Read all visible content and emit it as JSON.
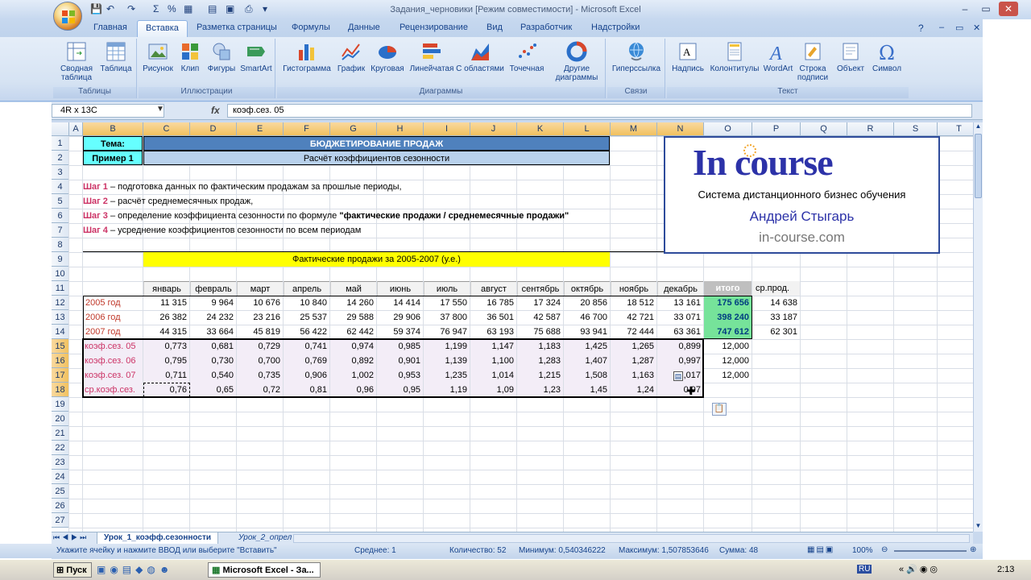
{
  "window": {
    "title": "Задания_черновики  [Режим совместимости] - Microsoft Excel"
  },
  "tabs": [
    "Главная",
    "Вставка",
    "Разметка страницы",
    "Формулы",
    "Данные",
    "Рецензирование",
    "Вид",
    "Разработчик",
    "Надстройки"
  ],
  "active_tab": "Вставка",
  "ribbon": {
    "groups": [
      {
        "label": "Таблицы",
        "buttons": [
          "Сводная таблица",
          "Таблица"
        ]
      },
      {
        "label": "Иллюстрации",
        "buttons": [
          "Рисунок",
          "Клип",
          "Фигуры",
          "SmartArt"
        ]
      },
      {
        "label": "Диаграммы",
        "buttons": [
          "Гистограмма",
          "График",
          "Круговая",
          "Линейчатая",
          "С областями",
          "Точечная",
          "Другие диаграммы"
        ]
      },
      {
        "label": "Связи",
        "buttons": [
          "Гиперссылка"
        ]
      },
      {
        "label": "Текст",
        "buttons": [
          "Надпись",
          "Колонтитулы",
          "WordArt",
          "Строка подписи",
          "Объект",
          "Символ"
        ]
      }
    ]
  },
  "formula_bar": {
    "name_box": "4R x 13C",
    "fx": "fx",
    "formula": "коэф.сез. 05"
  },
  "columns": [
    "A",
    "B",
    "C",
    "D",
    "E",
    "F",
    "G",
    "H",
    "I",
    "J",
    "K",
    "L",
    "M",
    "N",
    "O",
    "P",
    "Q",
    "R",
    "S",
    "T"
  ],
  "rows": [
    "1",
    "2",
    "3",
    "4",
    "5",
    "6",
    "7",
    "8",
    "9",
    "10",
    "11",
    "12",
    "13",
    "14",
    "15",
    "16",
    "17",
    "18",
    "19",
    "20",
    "21",
    "22",
    "23",
    "24",
    "25",
    "26",
    "27"
  ],
  "cells": {
    "theme_label": "Тема:",
    "theme_value": "БЮДЖЕТИРОВАНИЕ ПРОДАЖ",
    "example_label": "Пример 1",
    "example_value": "Расчёт коэффициентов сезонности",
    "step1_head": "Шаг 1",
    "step1_text": " – подготовка данных по фактическим продажам за прошлые периоды,",
    "step2_head": "Шаг 2",
    "step2_text": " – расчёт среднемесячных продаж,",
    "step3_head": "Шаг 3",
    "step3_text": " – определение коэффициента сезонности по формуле ",
    "step3_bold": "\"фактические продажи / среднемесячные продажи\"",
    "step4_head": "Шаг 4",
    "step4_text": " – усреднение коэффициентов сезонности по всем периодам",
    "sales_header": "Фактические продажи за 2005-2007 (у.е.)",
    "months": [
      "январь",
      "февраль",
      "март",
      "апрель",
      "май",
      "июнь",
      "июль",
      "август",
      "сентябрь",
      "октябрь",
      "ноябрь",
      "декабрь"
    ],
    "total_label": "итого",
    "avg_label": "ср.прод.",
    "data_rows": [
      {
        "label": "2005 год",
        "values": [
          "11 315",
          "9 964",
          "10 676",
          "10 840",
          "14 260",
          "14 414",
          "17 550",
          "16 785",
          "17 324",
          "20 856",
          "18 512",
          "13 161"
        ],
        "total": "175 656",
        "avg": "14 638"
      },
      {
        "label": "2006 год",
        "values": [
          "26 382",
          "24 232",
          "23 216",
          "25 537",
          "29 588",
          "29 906",
          "37 800",
          "36 501",
          "42 587",
          "46 700",
          "42 721",
          "33 071"
        ],
        "total": "398 240",
        "avg": "33 187"
      },
      {
        "label": "2007 год",
        "values": [
          "44 315",
          "33 664",
          "45 819",
          "56 422",
          "62 442",
          "59 374",
          "76 947",
          "63 193",
          "75 688",
          "93 941",
          "72 444",
          "63 361"
        ],
        "total": "747 612",
        "avg": "62 301"
      }
    ],
    "coef_rows": [
      {
        "label": "коэф.сез. 05",
        "values": [
          "0,773",
          "0,681",
          "0,729",
          "0,741",
          "0,974",
          "0,985",
          "1,199",
          "1,147",
          "1,183",
          "1,425",
          "1,265",
          "0,899"
        ],
        "total": "12,000"
      },
      {
        "label": "коэф.сез. 06",
        "values": [
          "0,795",
          "0,730",
          "0,700",
          "0,769",
          "0,892",
          "0,901",
          "1,139",
          "1,100",
          "1,283",
          "1,407",
          "1,287",
          "0,997"
        ],
        "total": "12,000"
      },
      {
        "label": "коэф.сез. 07",
        "values": [
          "0,711",
          "0,540",
          "0,735",
          "0,906",
          "1,002",
          "0,953",
          "1,235",
          "1,014",
          "1,215",
          "1,508",
          "1,163",
          "1,017"
        ],
        "total": "12,000"
      },
      {
        "label": "ср.коэф.сез.",
        "values": [
          "0,76",
          "0,65",
          "0,72",
          "0,81",
          "0,96",
          "0,95",
          "1,19",
          "1,09",
          "1,23",
          "1,45",
          "1,24",
          "0,97"
        ],
        "total": ""
      }
    ]
  },
  "logo": {
    "brand": "In course",
    "subtitle": "Система дистанционного бизнес обучения",
    "author": "Андрей Стыгарь",
    "site": "in-course.com"
  },
  "sheet_tabs": [
    "Урок_1_коэфф.сезонности",
    "Урок_2_опрел"
  ],
  "status": {
    "message": "Укажите ячейку и нажмите ВВОД или выберите \"Вставить\"",
    "average": "Среднее: 1",
    "count": "Количество: 52",
    "min": "Минимум: 0,540346222",
    "max": "Максимум: 1,507853646",
    "sum": "Сумма: 48",
    "zoom": "100%"
  },
  "taskbar": {
    "start": "Пуск",
    "task": "Microsoft Excel - За...",
    "lang": "RU",
    "time": "2:13"
  },
  "colors": {
    "accent_blue": "#4f81bd",
    "green": "#76e39a",
    "yellow": "#ffff00",
    "cyan": "#66ffff",
    "pink": "#cc3366"
  }
}
